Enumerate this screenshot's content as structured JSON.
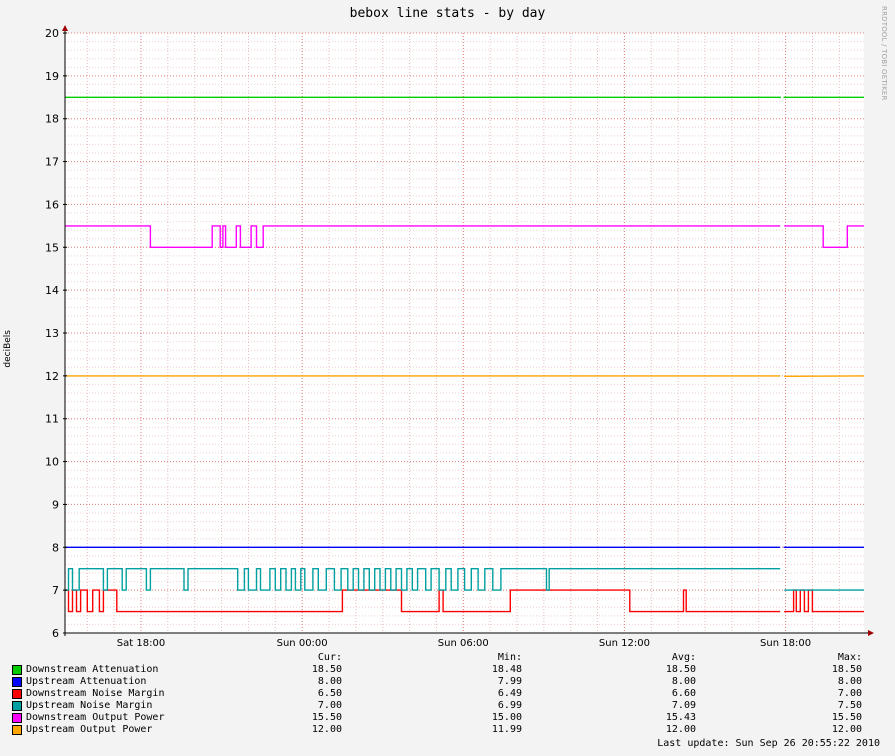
{
  "chart_data": {
    "type": "line",
    "title": "bebox line stats - by day",
    "ylabel": "deciBels",
    "xlabel": "",
    "ylim": [
      6,
      20
    ],
    "y_ticks": [
      6,
      7,
      8,
      9,
      10,
      11,
      12,
      13,
      14,
      15,
      16,
      17,
      18,
      19,
      20
    ],
    "x_range": [
      "Sat 15:10",
      "Sun 20:55"
    ],
    "x_ticks": [
      "Sat 18:00",
      "Sun 00:00",
      "Sun 06:00",
      "Sun 12:00",
      "Sun 18:00"
    ],
    "x_tick_hours": [
      18,
      24,
      30,
      36,
      42
    ],
    "grid": true,
    "series": [
      {
        "name": "Downstream Attenuation",
        "color": "#00cc00",
        "x_hours": [
          15.17,
          41.8,
          41.8,
          41.95,
          41.95,
          44.92
        ],
        "values": [
          18.5,
          18.5,
          18.48,
          18.48,
          18.5,
          18.5
        ],
        "gaps_after_hours": [
          41.85
        ]
      },
      {
        "name": "Upstream Attenuation",
        "color": "#0000ff",
        "x_hours": [
          15.17,
          41.8,
          41.95,
          41.95,
          44.92
        ],
        "values": [
          8.0,
          8.0,
          7.99,
          8.0,
          8.0
        ],
        "gaps_after_hours": [
          41.85
        ]
      },
      {
        "name": "Downstream Noise Margin",
        "color": "#ff0000",
        "x_hours": [
          15.17,
          15.3,
          15.3,
          15.45,
          15.45,
          15.6,
          15.6,
          15.75,
          15.75,
          16.0,
          16.0,
          16.2,
          16.2,
          16.45,
          16.45,
          16.6,
          16.6,
          16.85,
          16.85,
          17.1,
          17.1,
          17.25,
          17.25,
          25.5,
          25.5,
          27.7,
          27.7,
          27.85,
          27.85,
          29.1,
          29.1,
          29.25,
          29.25,
          31.75,
          31.75,
          36.2,
          36.2,
          36.3,
          36.3,
          38.2,
          38.2,
          38.3,
          38.3,
          41.8,
          41.95,
          42.3,
          42.3,
          42.4,
          42.4,
          42.55,
          42.55,
          42.7,
          42.7,
          42.85,
          42.85,
          43.0,
          43.0,
          44.92
        ],
        "values": [
          7.0,
          7.0,
          6.5,
          6.5,
          7.0,
          7.0,
          6.5,
          6.5,
          7.0,
          7.0,
          6.5,
          6.5,
          7.0,
          7.0,
          6.5,
          6.5,
          7.0,
          7.0,
          7.0,
          7.0,
          6.5,
          6.5,
          6.5,
          6.5,
          7.0,
          7.0,
          6.5,
          6.5,
          6.5,
          6.5,
          7.0,
          7.0,
          6.5,
          6.5,
          7.0,
          7.0,
          6.5,
          6.5,
          6.5,
          6.5,
          7.0,
          7.0,
          6.5,
          6.5,
          6.5,
          6.5,
          7.0,
          7.0,
          6.5,
          6.5,
          7.0,
          7.0,
          6.5,
          6.5,
          7.0,
          7.0,
          6.5,
          6.5
        ],
        "gaps_after_hours": [
          41.85
        ]
      },
      {
        "name": "Upstream Noise Margin",
        "color": "#00a0a0",
        "x_hours": [
          15.17,
          15.3,
          15.3,
          15.45,
          15.45,
          15.7,
          15.7,
          16.6,
          16.6,
          16.75,
          16.75,
          17.3,
          17.3,
          17.45,
          17.45,
          18.2,
          18.2,
          18.35,
          18.35,
          19.6,
          19.6,
          19.75,
          19.75,
          21.6,
          21.6,
          21.85,
          21.85,
          22.0,
          22.0,
          22.3,
          22.3,
          22.45,
          22.45,
          22.8,
          22.8,
          23.0,
          23.0,
          23.2,
          23.2,
          23.4,
          23.4,
          23.6,
          23.6,
          23.75,
          23.75,
          23.95,
          23.95,
          24.1,
          24.1,
          24.4,
          24.4,
          24.6,
          24.6,
          24.9,
          24.9,
          25.2,
          25.2,
          25.45,
          25.45,
          25.7,
          25.7,
          25.9,
          25.9,
          26.1,
          26.1,
          26.3,
          26.3,
          26.5,
          26.5,
          26.7,
          26.7,
          26.9,
          26.9,
          27.1,
          27.1,
          27.3,
          27.3,
          27.5,
          27.5,
          27.7,
          27.7,
          27.9,
          27.9,
          28.1,
          28.1,
          28.3,
          28.3,
          28.6,
          28.6,
          28.8,
          28.8,
          29.1,
          29.1,
          29.35,
          29.35,
          29.55,
          29.55,
          29.8,
          29.8,
          30.05,
          30.05,
          30.3,
          30.3,
          30.55,
          30.55,
          30.8,
          30.8,
          31.1,
          31.1,
          31.4,
          31.4,
          33.1,
          33.1,
          33.2,
          33.2,
          41.8,
          41.95,
          44.92
        ],
        "values": [
          7.0,
          7.0,
          7.5,
          7.5,
          7.0,
          7.0,
          7.5,
          7.5,
          7.0,
          7.0,
          7.5,
          7.5,
          7.0,
          7.0,
          7.5,
          7.5,
          7.0,
          7.0,
          7.5,
          7.5,
          7.0,
          7.0,
          7.5,
          7.5,
          7.0,
          7.0,
          7.5,
          7.5,
          7.0,
          7.0,
          7.5,
          7.5,
          7.0,
          7.0,
          7.5,
          7.5,
          7.0,
          7.0,
          7.5,
          7.5,
          7.0,
          7.0,
          7.5,
          7.5,
          7.0,
          7.0,
          7.5,
          7.5,
          7.0,
          7.0,
          7.5,
          7.5,
          7.0,
          7.0,
          7.5,
          7.5,
          7.0,
          7.0,
          7.5,
          7.5,
          7.0,
          7.0,
          7.5,
          7.5,
          7.0,
          7.0,
          7.5,
          7.5,
          7.0,
          7.0,
          7.5,
          7.5,
          7.0,
          7.0,
          7.5,
          7.5,
          7.0,
          7.0,
          7.5,
          7.5,
          7.0,
          7.0,
          7.5,
          7.5,
          7.0,
          7.0,
          7.5,
          7.5,
          7.0,
          7.0,
          7.5,
          7.5,
          7.0,
          7.0,
          7.5,
          7.5,
          7.0,
          7.0,
          7.5,
          7.5,
          7.0,
          7.0,
          7.5,
          7.5,
          7.0,
          7.0,
          7.5,
          7.5,
          7.0,
          7.0,
          7.5,
          7.5,
          7.0,
          7.0,
          7.5,
          7.5,
          7.0,
          7.0,
          7.0,
          7.0
        ],
        "gaps_after_hours": [
          41.85
        ]
      },
      {
        "name": "Downstream Output Power",
        "color": "#ff00ff",
        "x_hours": [
          15.17,
          18.35,
          18.35,
          20.65,
          20.65,
          20.95,
          20.95,
          21.05,
          21.05,
          21.15,
          21.15,
          21.55,
          21.55,
          21.7,
          21.7,
          22.1,
          22.1,
          22.3,
          22.3,
          22.55,
          22.55,
          41.8,
          41.95,
          43.4,
          43.4,
          44.3,
          44.3,
          44.92
        ],
        "values": [
          15.5,
          15.5,
          15.0,
          15.0,
          15.5,
          15.5,
          15.0,
          15.0,
          15.5,
          15.5,
          15.0,
          15.0,
          15.5,
          15.5,
          15.0,
          15.0,
          15.5,
          15.5,
          15.0,
          15.0,
          15.5,
          15.5,
          15.5,
          15.5,
          15.0,
          15.0,
          15.5,
          15.5
        ],
        "gaps_after_hours": [
          41.85
        ]
      },
      {
        "name": "Upstream Output Power",
        "color": "#ffa500",
        "x_hours": [
          15.17,
          41.8,
          41.95,
          44.92
        ],
        "values": [
          12.0,
          12.0,
          11.99,
          12.0
        ],
        "gaps_after_hours": [
          41.85
        ]
      }
    ]
  },
  "legend": {
    "headers": {
      "cur": "Cur:",
      "min": "Min:",
      "avg": "Avg:",
      "max": "Max:"
    },
    "rows": [
      {
        "name": "Downstream Attenuation",
        "color": "#00cc00",
        "cur": "18.50",
        "min": "18.48",
        "avg": "18.50",
        "max": "18.50"
      },
      {
        "name": "Upstream Attenuation",
        "color": "#0000ff",
        "cur": "8.00",
        "min": "7.99",
        "avg": "8.00",
        "max": "8.00"
      },
      {
        "name": "Downstream Noise Margin",
        "color": "#ff0000",
        "cur": "6.50",
        "min": "6.49",
        "avg": "6.60",
        "max": "7.00"
      },
      {
        "name": "Upstream Noise Margin",
        "color": "#00a0a0",
        "cur": "7.00",
        "min": "6.99",
        "avg": "7.09",
        "max": "7.50"
      },
      {
        "name": "Downstream Output Power",
        "color": "#ff00ff",
        "cur": "15.50",
        "min": "15.00",
        "avg": "15.43",
        "max": "15.50"
      },
      {
        "name": "Upstream Output Power",
        "color": "#ffa500",
        "cur": "12.00",
        "min": "11.99",
        "avg": "12.00",
        "max": "12.00"
      }
    ]
  },
  "last_update": "Last update: Sun Sep 26 20:55:22 2010",
  "side_credit": "RRDTOOL / TOBI OETIKER"
}
